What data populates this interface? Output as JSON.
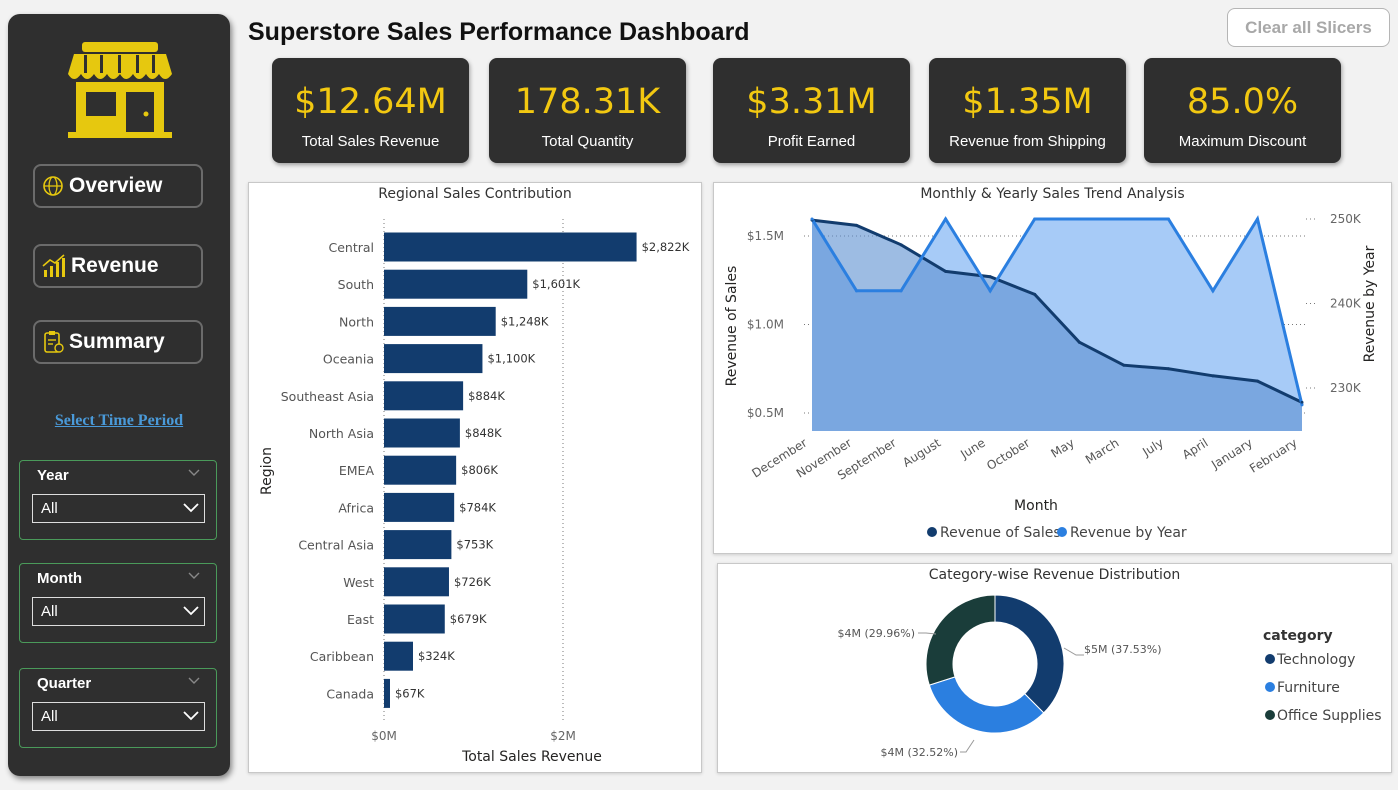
{
  "header": {
    "title": "Superstore Sales Performance Dashboard",
    "clear_button": "Clear all Slicers"
  },
  "nav": {
    "overview": "Overview",
    "revenue": "Revenue",
    "summary": "Summary",
    "time_link": "Select Time Period"
  },
  "slicers": [
    {
      "title": "Year",
      "value": "All"
    },
    {
      "title": "Month",
      "value": "All"
    },
    {
      "title": "Quarter",
      "value": "All"
    }
  ],
  "kpis": [
    {
      "value": "$12.64M",
      "label": "Total Sales Revenue"
    },
    {
      "value": "178.31K",
      "label": "Total Quantity"
    },
    {
      "value": "$3.31M",
      "label": "Profit Earned"
    },
    {
      "value": "$1.35M",
      "label": "Revenue from Shipping"
    },
    {
      "value": "85.0%",
      "label": "Maximum Discount"
    }
  ],
  "colors": {
    "accent": "#f2c811",
    "sidebar": "#2f2f2f",
    "bar": "#123c6e",
    "line_dark": "#123c6e",
    "line_light": "#2b7fe0",
    "donut_tech": "#123c6e",
    "donut_furn": "#2b7fe0",
    "donut_office": "#1a3d3a"
  },
  "icons": {
    "logo": "store-icon",
    "overview": "globe-icon",
    "revenue": "growth-chart-icon",
    "summary": "clipboard-icon"
  },
  "chart_data": [
    {
      "type": "bar",
      "title": "Regional Sales Contribution",
      "xlabel": "Total Sales Revenue",
      "ylabel": "Region",
      "categories": [
        "Central",
        "South",
        "North",
        "Oceania",
        "Southeast Asia",
        "North Asia",
        "EMEA",
        "Africa",
        "Central Asia",
        "West",
        "East",
        "Caribbean",
        "Canada"
      ],
      "values": [
        2822,
        1601,
        1248,
        1100,
        884,
        848,
        806,
        784,
        753,
        726,
        679,
        324,
        67
      ],
      "labels": [
        "$2,822K",
        "$1,601K",
        "$1,248K",
        "$1,100K",
        "$884K",
        "$848K",
        "$806K",
        "$784K",
        "$753K",
        "$726K",
        "$679K",
        "$324K",
        "$67K"
      ],
      "x_ticks": [
        "$0M",
        "$2M"
      ],
      "xlim": [
        0,
        3000
      ],
      "unit": "K"
    },
    {
      "type": "area",
      "title": "Monthly & Yearly Sales Trend Analysis",
      "xlabel": "Month",
      "ylabel": "Revenue of Sales",
      "y2label": "Revenue by Year",
      "categories": [
        "December",
        "November",
        "September",
        "August",
        "June",
        "October",
        "May",
        "March",
        "July",
        "April",
        "January",
        "February"
      ],
      "series": [
        {
          "name": "Revenue of Sales",
          "axis": "left",
          "values": [
            1.59,
            1.56,
            1.45,
            1.3,
            1.27,
            1.17,
            0.9,
            0.77,
            0.75,
            0.71,
            0.68,
            0.56
          ]
        },
        {
          "name": "Revenue by Year",
          "axis": "right",
          "values": [
            250,
            241.5,
            241.5,
            250,
            241.5,
            250,
            250,
            250,
            250,
            241.5,
            250,
            228
          ]
        }
      ],
      "y_ticks": [
        "$0.5M",
        "$1.0M",
        "$1.5M"
      ],
      "y2_ticks": [
        "230K",
        "240K",
        "250K"
      ],
      "ylim": [
        0.35,
        1.75
      ],
      "y2lim": [
        226,
        252
      ]
    },
    {
      "type": "pie",
      "title": "Category-wise Revenue Distribution",
      "legend_title": "category",
      "categories": [
        "Technology",
        "Furniture",
        "Office Supplies"
      ],
      "values": [
        37.53,
        32.52,
        29.96
      ],
      "labels": [
        "$5M (37.53%)",
        "$4M (32.52%)",
        "$4M (29.96%)"
      ]
    }
  ]
}
